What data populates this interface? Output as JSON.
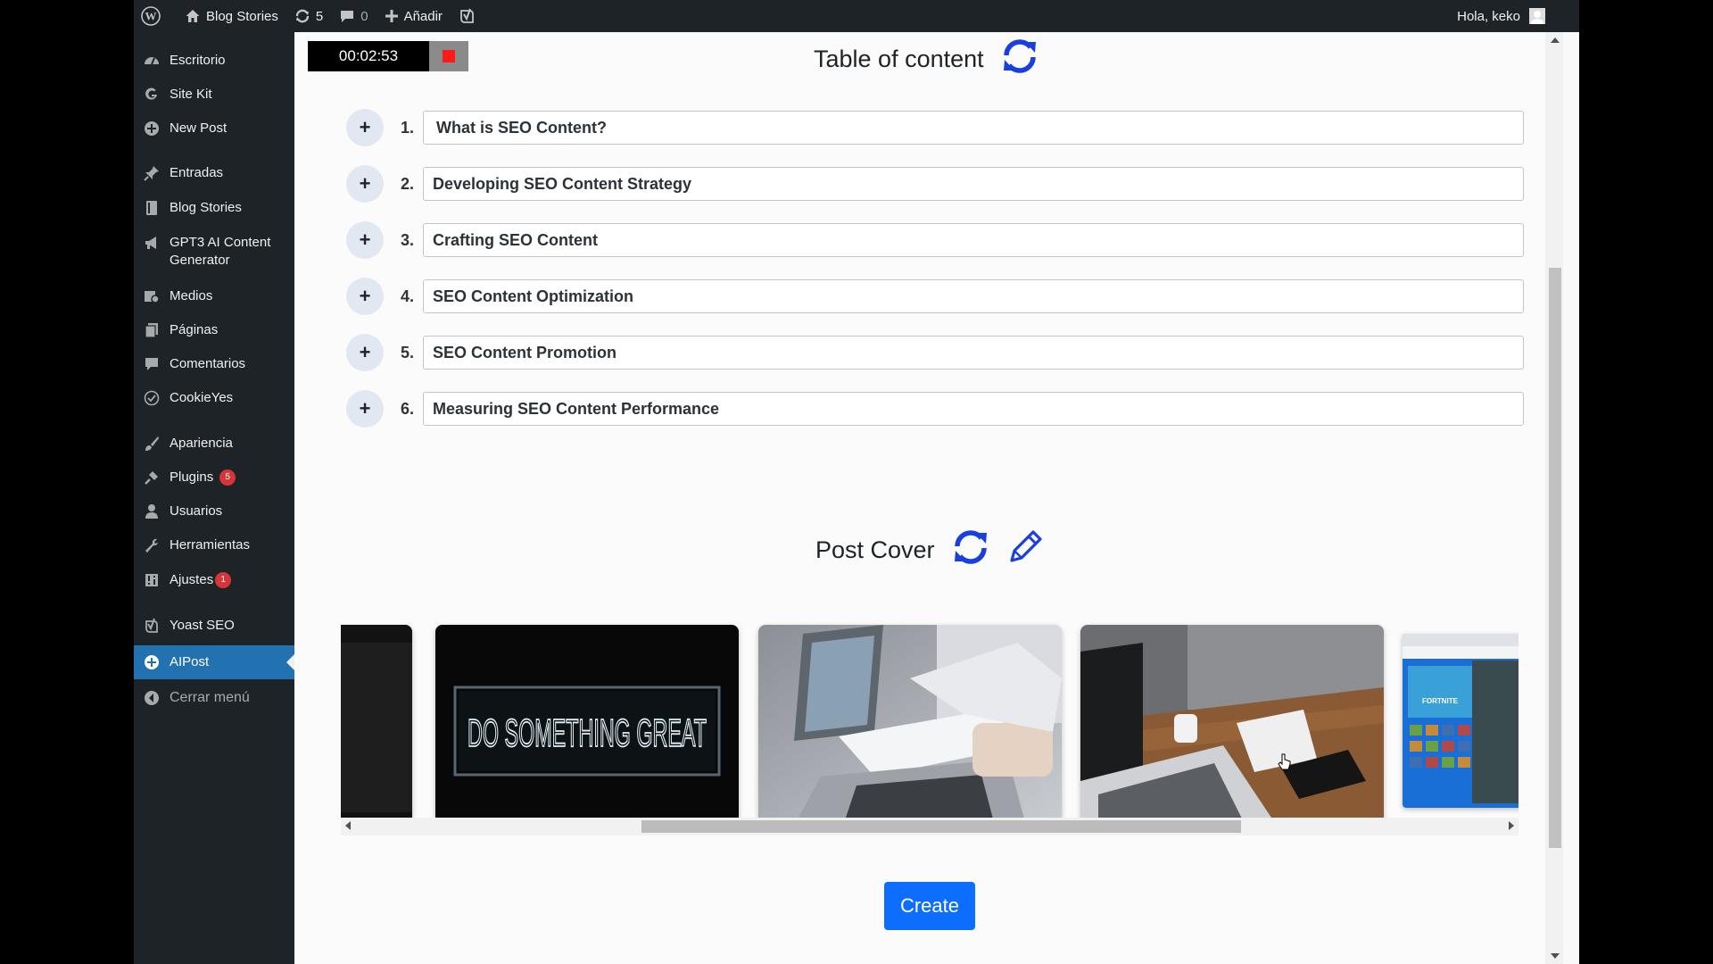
{
  "recorder": {
    "time": "00:02:53"
  },
  "adminbar": {
    "site_name": "Blog Stories",
    "updates": "5",
    "comments": "0",
    "add_new": "Añadir",
    "greeting": "Hola, keko"
  },
  "sidebar": {
    "items": [
      {
        "label": "Escritorio",
        "icon": "dashboard-icon"
      },
      {
        "label": "Site Kit",
        "icon": "google-g-icon"
      },
      {
        "label": "New Post",
        "icon": "plus-circle-icon"
      },
      {
        "label": "Entradas",
        "icon": "pin-icon"
      },
      {
        "label": "Blog Stories",
        "icon": "book-icon"
      },
      {
        "label": "GPT3 AI Content Generator",
        "icon": "megaphone-icon"
      },
      {
        "label": "Medios",
        "icon": "media-icon"
      },
      {
        "label": "Páginas",
        "icon": "pages-icon"
      },
      {
        "label": "Comentarios",
        "icon": "comment-icon"
      },
      {
        "label": "CookieYes",
        "icon": "cookie-icon"
      },
      {
        "label": "Apariencia",
        "icon": "brush-icon"
      },
      {
        "label": "Plugins",
        "icon": "plug-icon",
        "badge": "5"
      },
      {
        "label": "Usuarios",
        "icon": "user-icon"
      },
      {
        "label": "Herramientas",
        "icon": "wrench-icon"
      },
      {
        "label": "Ajustes",
        "icon": "settings-icon",
        "badge": "1"
      },
      {
        "label": "Yoast SEO",
        "icon": "yoast-icon"
      },
      {
        "label": "AIPost",
        "icon": "plus-circle-icon",
        "active": true
      },
      {
        "label": "Cerrar menú",
        "icon": "collapse-icon"
      }
    ]
  },
  "toc": {
    "title": "Table of content",
    "items": [
      {
        "num": "1.",
        "value": "What is SEO Content?"
      },
      {
        "num": "2.",
        "value": "Developing SEO Content Strategy"
      },
      {
        "num": "3.",
        "value": "Crafting SEO Content"
      },
      {
        "num": "4.",
        "value": "SEO Content Optimization"
      },
      {
        "num": "5.",
        "value": "SEO Content Promotion"
      },
      {
        "num": "6.",
        "value": "Measuring SEO Content Performance"
      }
    ]
  },
  "cover": {
    "title": "Post Cover",
    "neon_text": "DO SOMETHING GREAT",
    "game_text": "FORTNITE"
  },
  "create_label": "Create",
  "colors": {
    "accent": "#2271b1",
    "icon_blue": "#1a3fe0",
    "create": "#0d6efd",
    "admin_bg": "#1d2327"
  }
}
